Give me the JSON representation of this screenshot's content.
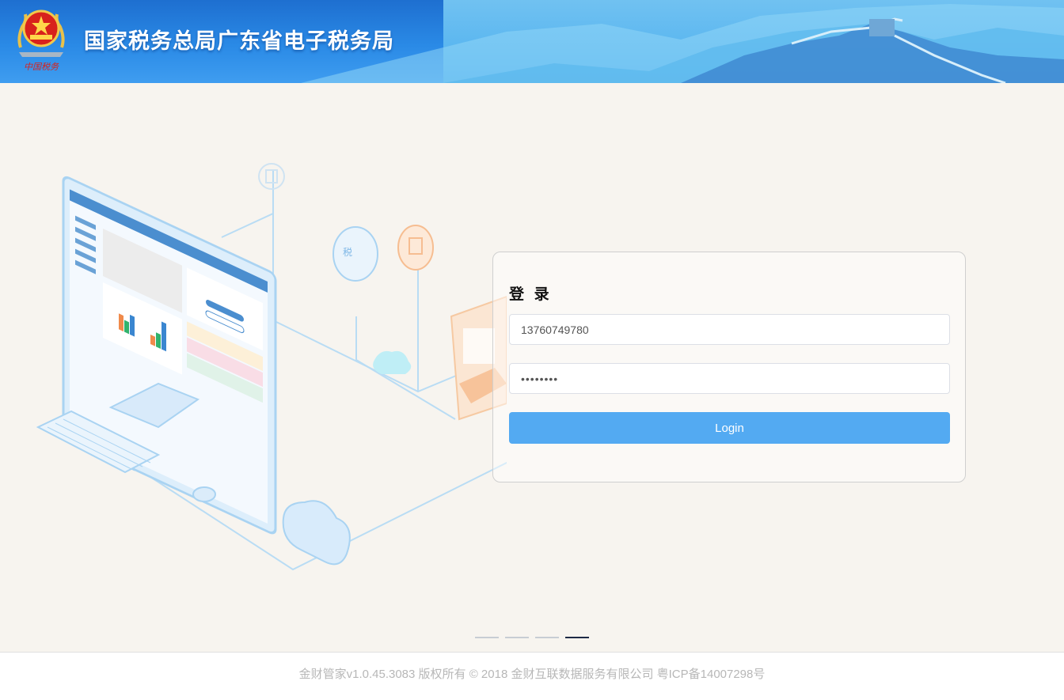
{
  "header": {
    "title": "国家税务总局广东省电子税务局",
    "emblem_caption": "中国税务"
  },
  "login": {
    "title": "登 录",
    "username_value": "13760749780",
    "password_value": "••••••••",
    "button_label": "Login"
  },
  "carousel": {
    "count": 4,
    "active_index": 3
  },
  "footer": {
    "text": "金财管家v1.0.45.3083 版权所有 © 2018 金财互联数据服务有限公司 粤ICP备14007298号"
  },
  "colors": {
    "header_blue": "#2a8ae6",
    "login_button": "#53aaf2",
    "page_bg": "#f7f4ef"
  }
}
